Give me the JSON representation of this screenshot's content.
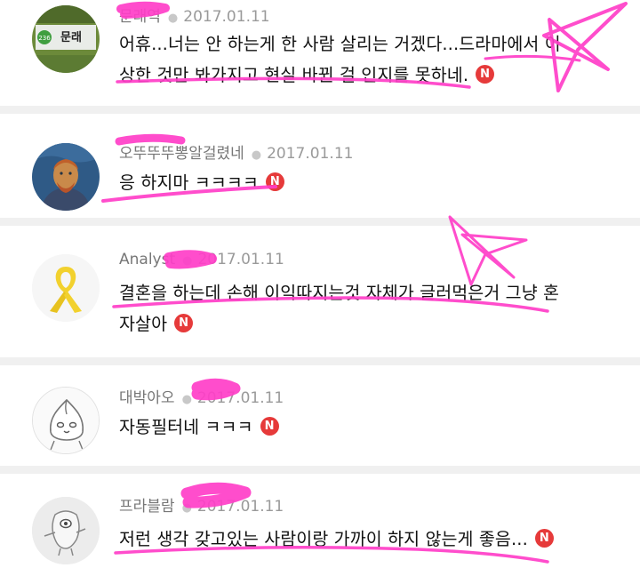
{
  "comments": [
    {
      "author": "문래역",
      "date": "2017.01.11",
      "lines": [
        "어휴...너는 안 하는게 한 사람 살리는 거겠다...드라마에서 이",
        "상한 것만 봐가지고 현실 바뀐 걸 인지를 못하네."
      ],
      "badge": "N",
      "avatar_icon": "station-sign-icon"
    },
    {
      "author": "오뚜뚜뚜뽕알걸렸네",
      "date": "2017.01.11",
      "lines": [
        "응 하지마 ㅋㅋㅋㅋ"
      ],
      "badge": "N",
      "avatar_icon": "painting-portrait-icon"
    },
    {
      "author": "Analyst",
      "date": "2017.01.11",
      "lines": [
        "결혼을 하는데 손해 이익따지는것 자체가 글러먹은거 그냥 혼",
        "자살아"
      ],
      "badge": "N",
      "avatar_icon": "yellow-ribbon-icon"
    },
    {
      "author": "대박아오",
      "date": "2017.01.11",
      "lines": [
        "자동필터네 ㅋㅋㅋ"
      ],
      "badge": "N",
      "avatar_icon": "peach-character-icon"
    },
    {
      "author": "프라블람",
      "date": "2017.01.11",
      "lines": [
        "저런 생각 갖고있는 사람이랑 가까이 하지 않는게 좋음..."
      ],
      "badge": "N",
      "avatar_icon": "alien-character-icon"
    }
  ],
  "station_sign": {
    "number": "236",
    "name": "문래"
  },
  "colors": {
    "highlighter": "#ff3ec8",
    "badge": "#e63a3a",
    "divider": "#f0f0f0"
  }
}
